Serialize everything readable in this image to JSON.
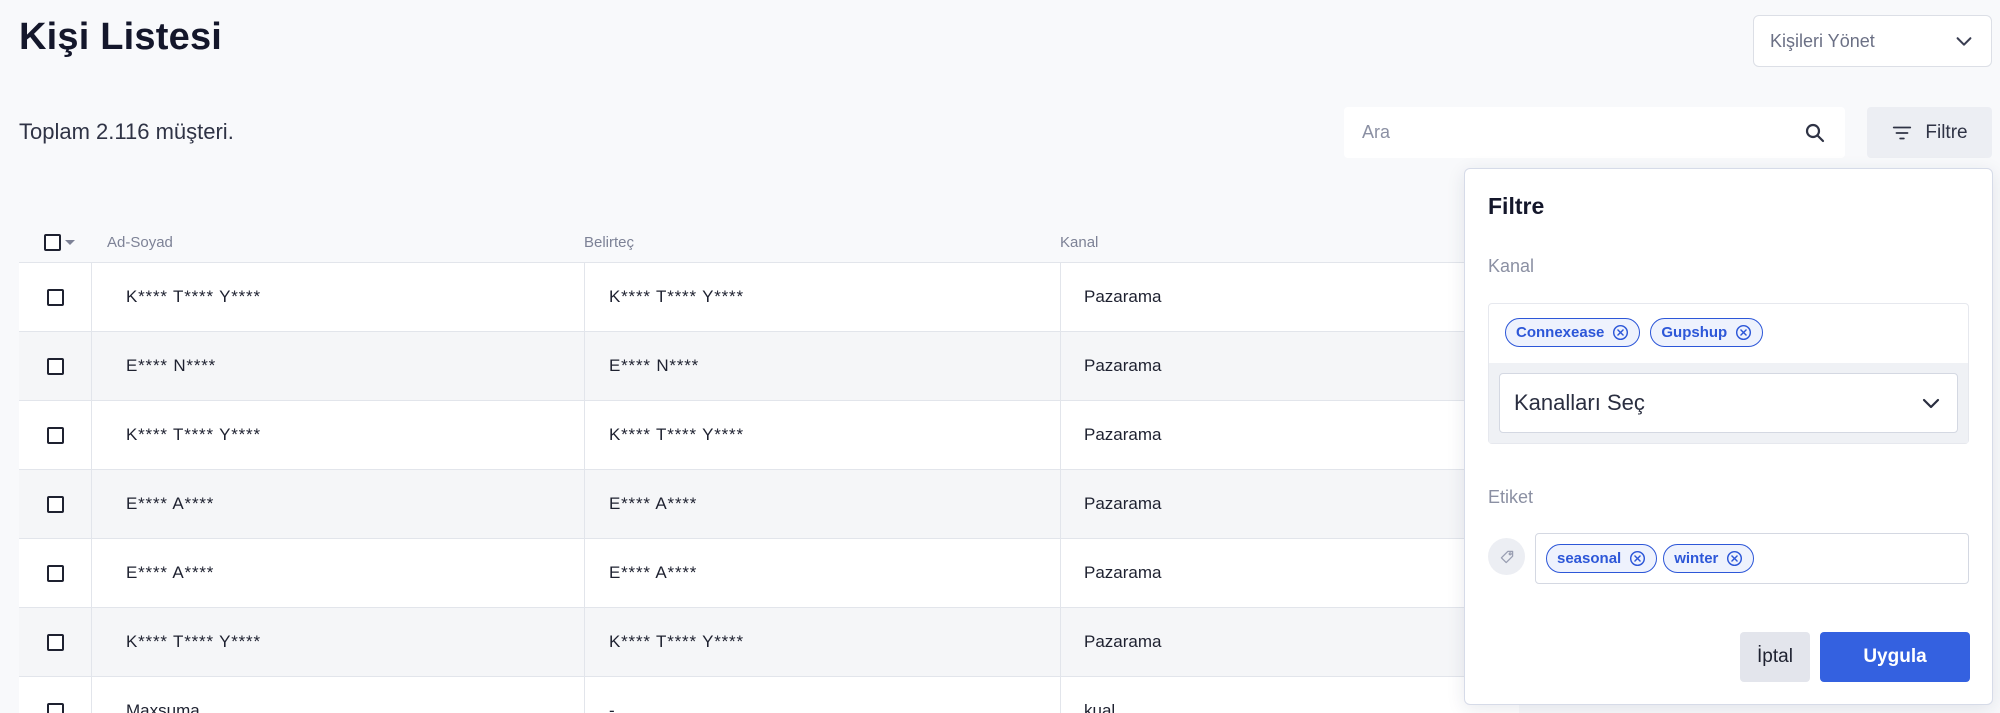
{
  "header": {
    "title": "Kişi Listesi",
    "manage_label": "Kişileri Yönet"
  },
  "summary": {
    "total_text": "Toplam 2.116 müşteri."
  },
  "search": {
    "placeholder": "Ara"
  },
  "filter_button": {
    "label": "Filtre"
  },
  "table": {
    "columns": [
      "Ad-Soyad",
      "Belirteç",
      "Kanal"
    ],
    "rows": [
      {
        "name": "K**** T**** Y****",
        "id": "K**** T**** Y****",
        "kanal": "Pazarama"
      },
      {
        "name": "E**** N****",
        "id": "E**** N****",
        "kanal": "Pazarama"
      },
      {
        "name": "K**** T**** Y****",
        "id": "K**** T**** Y****",
        "kanal": "Pazarama"
      },
      {
        "name": "E**** A****",
        "id": "E**** A****",
        "kanal": "Pazarama"
      },
      {
        "name": "E**** A****",
        "id": "E**** A****",
        "kanal": "Pazarama"
      },
      {
        "name": "K**** T**** Y****",
        "id": "K**** T**** Y****",
        "kanal": "Pazarama"
      },
      {
        "name": "Maxsuma",
        "id": "-",
        "kanal": "kual"
      }
    ]
  },
  "filter_panel": {
    "title": "Filtre",
    "kanal_label": "Kanal",
    "kanal_chips": [
      "Connexease",
      "Gupshup"
    ],
    "kanal_select_label": "Kanalları Seç",
    "etiket_label": "Etiket",
    "etiket_chips": [
      "seasonal",
      "winter"
    ],
    "cancel_label": "İptal",
    "apply_label": "Uygula"
  },
  "colors": {
    "accent": "#3461e0",
    "chip_border": "#2d57d8",
    "background": "#f8f9fb"
  },
  "icons": {
    "manage": "chevron-down-icon",
    "search": "search-icon",
    "filter": "filter-lines-icon",
    "chip_remove": "close-circle-icon",
    "kanal_select": "chevron-down-icon",
    "etiket": "tag-icon"
  }
}
